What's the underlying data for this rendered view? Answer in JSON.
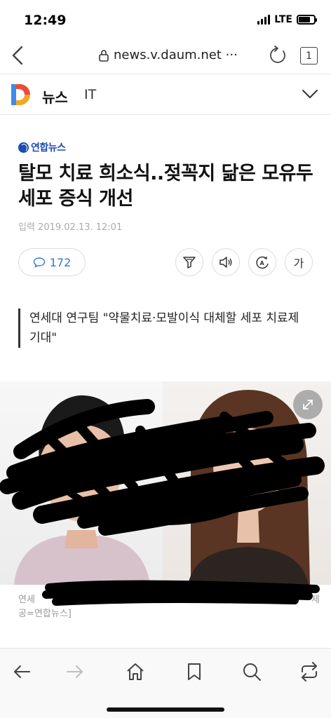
{
  "status_bar": {
    "time": "12:49",
    "network": "LTE"
  },
  "browser": {
    "url": "news.v.daum.net ···",
    "tab_count": "1"
  },
  "site_header": {
    "section": "뉴스",
    "category": "IT"
  },
  "article": {
    "press": "연합뉴스",
    "title": "탈모 치료 희소식..젖꼭지 닮은 모유두 세포 증식 개선",
    "date": "입력 2019.02.13. 12:01",
    "comment_count": "172",
    "font_button": "가",
    "subtitle": "연세대 연구팀 \"약물치료·모발이식 대체할 세포 치료제 기대\"",
    "caption_line1": "연세",
    "caption_line1_end": "제",
    "caption_line2": "공=연합뉴스]"
  },
  "colors": {
    "accent_blue": "#3478c6",
    "press_blue": "#1d4bb3",
    "redaction": "#000000"
  },
  "icons": {
    "back": "back-arrow-icon",
    "reload": "reload-icon",
    "lock": "lock-icon",
    "comment": "speech-bubble-icon",
    "filter": "filter-icon",
    "speaker": "speaker-icon",
    "translate": "translate-icon",
    "expand": "expand-icon",
    "home": "home-icon",
    "bookmark": "bookmark-icon",
    "search": "search-icon",
    "share": "share-icon"
  }
}
